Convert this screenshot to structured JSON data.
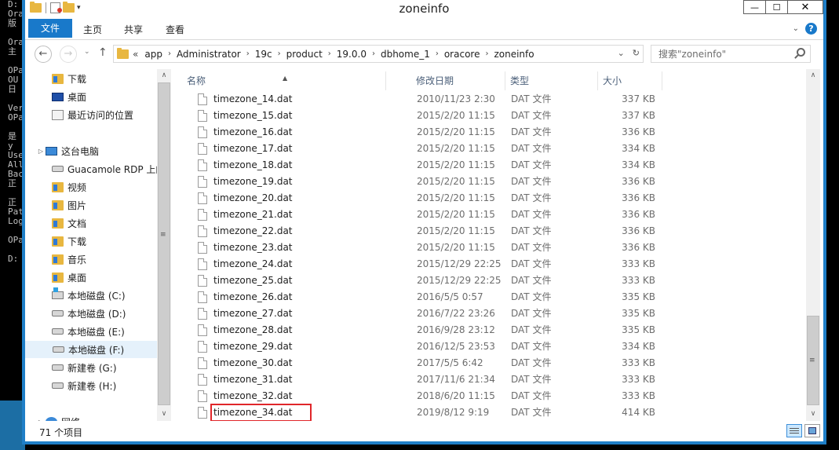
{
  "console": {
    "lines": [
      "D:",
      "Ora",
      "版",
      "",
      "Ora",
      "主",
      "",
      "OPa",
      "OU",
      "日",
      "",
      "Ver",
      "OPa",
      "",
      "是",
      "y",
      "Use",
      "All",
      "Bac",
      "正",
      "",
      "正",
      "Pat",
      "Log",
      "",
      "OPa",
      "",
      "D:"
    ]
  },
  "window": {
    "title": "zoneinfo",
    "min_label": "—",
    "max_label": "☐",
    "close_label": "✕"
  },
  "ribbon": {
    "tabs": [
      "文件",
      "主页",
      "共享",
      "查看"
    ],
    "collapse_glyph": "⌄",
    "help_glyph": "?"
  },
  "nav": {
    "back_glyph": "←",
    "forward_glyph": "→",
    "recent_glyph": "⌄",
    "up_glyph": "↑",
    "overflow": "«",
    "breadcrumbs": [
      "app",
      "Administrator",
      "19c",
      "product",
      "19.0.0",
      "dbhome_1",
      "oracore",
      "zoneinfo"
    ],
    "crumb_sep": "›",
    "dropdown_glyph": "⌄",
    "refresh_glyph": "↻",
    "search_placeholder": "搜索\"zoneinfo\""
  },
  "sidebar": {
    "items": [
      {
        "label": "下载",
        "icon": "downloads-folder-icon"
      },
      {
        "label": "桌面",
        "icon": "desktop-icon"
      },
      {
        "label": "最近访问的位置",
        "icon": "recent-places-icon"
      },
      {
        "label": "这台电脑",
        "icon": "this-pc-icon"
      },
      {
        "label": "Guacamole RDP 上的",
        "icon": "network-drive-icon"
      },
      {
        "label": "视频",
        "icon": "videos-folder-icon"
      },
      {
        "label": "图片",
        "icon": "pictures-folder-icon"
      },
      {
        "label": "文档",
        "icon": "documents-folder-icon"
      },
      {
        "label": "下载",
        "icon": "downloads-folder-icon"
      },
      {
        "label": "音乐",
        "icon": "music-folder-icon"
      },
      {
        "label": "桌面",
        "icon": "desktop-folder-icon"
      },
      {
        "label": "本地磁盘 (C:)",
        "icon": "system-drive-icon"
      },
      {
        "label": "本地磁盘 (D:)",
        "icon": "drive-icon"
      },
      {
        "label": "本地磁盘 (E:)",
        "icon": "drive-icon"
      },
      {
        "label": "本地磁盘 (F:)",
        "icon": "drive-icon"
      },
      {
        "label": "新建卷 (G:)",
        "icon": "drive-icon"
      },
      {
        "label": "新建卷 (H:)",
        "icon": "drive-icon"
      },
      {
        "label": "网络",
        "icon": "network-icon"
      }
    ],
    "selected_label": "本地磁盘 (F:)",
    "expand_glyph": "▷"
  },
  "columns": {
    "name": "名称",
    "date": "修改日期",
    "type": "类型",
    "size": "大小",
    "sort_glyph": "▲"
  },
  "files": [
    {
      "name": "timezone_14.dat",
      "date": "2010/11/23 2:30",
      "type": "DAT 文件",
      "size": "337 KB"
    },
    {
      "name": "timezone_15.dat",
      "date": "2015/2/20 11:15",
      "type": "DAT 文件",
      "size": "337 KB"
    },
    {
      "name": "timezone_16.dat",
      "date": "2015/2/20 11:15",
      "type": "DAT 文件",
      "size": "336 KB"
    },
    {
      "name": "timezone_17.dat",
      "date": "2015/2/20 11:15",
      "type": "DAT 文件",
      "size": "334 KB"
    },
    {
      "name": "timezone_18.dat",
      "date": "2015/2/20 11:15",
      "type": "DAT 文件",
      "size": "334 KB"
    },
    {
      "name": "timezone_19.dat",
      "date": "2015/2/20 11:15",
      "type": "DAT 文件",
      "size": "336 KB"
    },
    {
      "name": "timezone_20.dat",
      "date": "2015/2/20 11:15",
      "type": "DAT 文件",
      "size": "336 KB"
    },
    {
      "name": "timezone_21.dat",
      "date": "2015/2/20 11:15",
      "type": "DAT 文件",
      "size": "336 KB"
    },
    {
      "name": "timezone_22.dat",
      "date": "2015/2/20 11:15",
      "type": "DAT 文件",
      "size": "336 KB"
    },
    {
      "name": "timezone_23.dat",
      "date": "2015/2/20 11:15",
      "type": "DAT 文件",
      "size": "336 KB"
    },
    {
      "name": "timezone_24.dat",
      "date": "2015/12/29 22:25",
      "type": "DAT 文件",
      "size": "333 KB"
    },
    {
      "name": "timezone_25.dat",
      "date": "2015/12/29 22:25",
      "type": "DAT 文件",
      "size": "333 KB"
    },
    {
      "name": "timezone_26.dat",
      "date": "2016/5/5 0:57",
      "type": "DAT 文件",
      "size": "335 KB"
    },
    {
      "name": "timezone_27.dat",
      "date": "2016/7/22 23:26",
      "type": "DAT 文件",
      "size": "335 KB"
    },
    {
      "name": "timezone_28.dat",
      "date": "2016/9/28 23:12",
      "type": "DAT 文件",
      "size": "335 KB"
    },
    {
      "name": "timezone_29.dat",
      "date": "2016/12/5 23:53",
      "type": "DAT 文件",
      "size": "334 KB"
    },
    {
      "name": "timezone_30.dat",
      "date": "2017/5/5 6:42",
      "type": "DAT 文件",
      "size": "333 KB"
    },
    {
      "name": "timezone_31.dat",
      "date": "2017/11/6 21:34",
      "type": "DAT 文件",
      "size": "333 KB"
    },
    {
      "name": "timezone_32.dat",
      "date": "2018/6/20 11:15",
      "type": "DAT 文件",
      "size": "333 KB"
    },
    {
      "name": "timezone_34.dat",
      "date": "2019/8/12 9:19",
      "type": "DAT 文件",
      "size": "414 KB"
    }
  ],
  "highlighted_file": "timezone_34.dat",
  "status": {
    "item_count": "71 个项目"
  },
  "colors": {
    "window_border": "#1f7fc8",
    "file_tab": "#1979ca",
    "highlight": "#e0262a",
    "selection": "#e5f1fb"
  },
  "scroll": {
    "up_glyph": "∧",
    "down_glyph": "∨",
    "grip_glyph": "≡"
  }
}
